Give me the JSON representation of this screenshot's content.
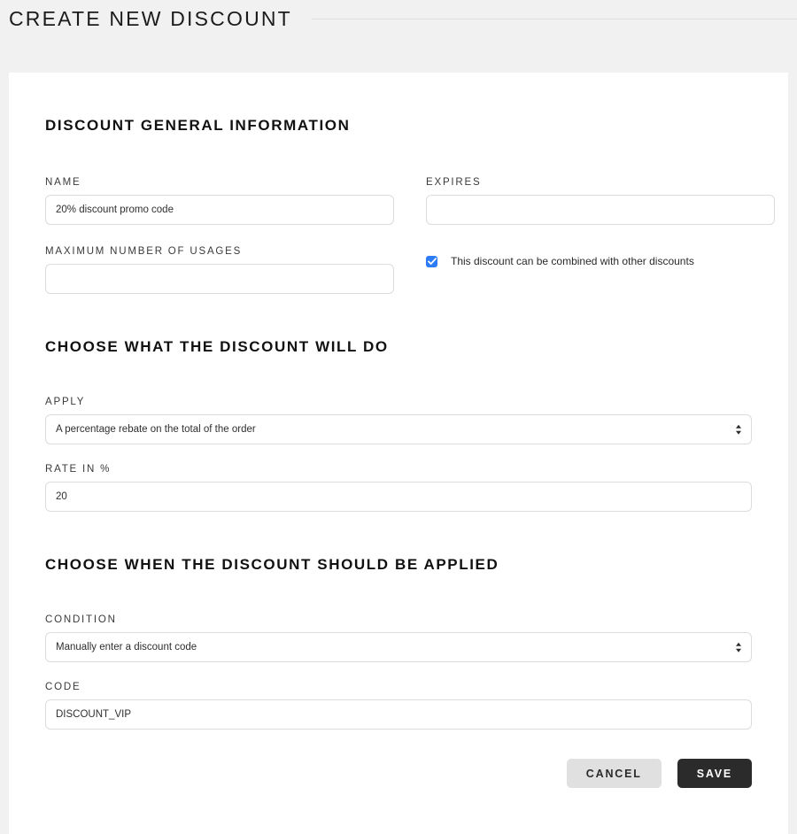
{
  "header": {
    "title": "CREATE NEW DISCOUNT"
  },
  "sections": {
    "general": {
      "title": "DISCOUNT GENERAL INFORMATION",
      "name_label": "NAME",
      "name_value": "20% discount promo code",
      "name_placeholder": "",
      "expires_label": "EXPIRES",
      "expires_value": "",
      "expires_placeholder": "",
      "max_usages_label": "MAXIMUM NUMBER OF USAGES",
      "max_usages_value": "",
      "max_usages_placeholder": "",
      "combine_checkbox_label": "This discount can be combined with other discounts",
      "combine_checked": true
    },
    "what": {
      "title": "CHOOSE WHAT THE DISCOUNT WILL DO",
      "apply_label": "APPLY",
      "apply_selected": "A percentage rebate on the total of the order",
      "rate_label": "RATE IN %",
      "rate_value": "20",
      "rate_placeholder": ""
    },
    "when": {
      "title": "CHOOSE WHEN THE DISCOUNT SHOULD BE APPLIED",
      "condition_label": "CONDITION",
      "condition_selected": "Manually enter a discount code",
      "code_label": "CODE",
      "code_value": "DISCOUNT_VIP",
      "code_placeholder": ""
    }
  },
  "actions": {
    "cancel_label": "CANCEL",
    "save_label": "SAVE"
  },
  "colors": {
    "page_background": "#f1f1f1",
    "card_background": "#ffffff",
    "border": "#dcdcdc",
    "checkbox_accent": "#2b7cf6",
    "save_button": "#2b2b2b",
    "cancel_button": "#e0e0e0"
  }
}
